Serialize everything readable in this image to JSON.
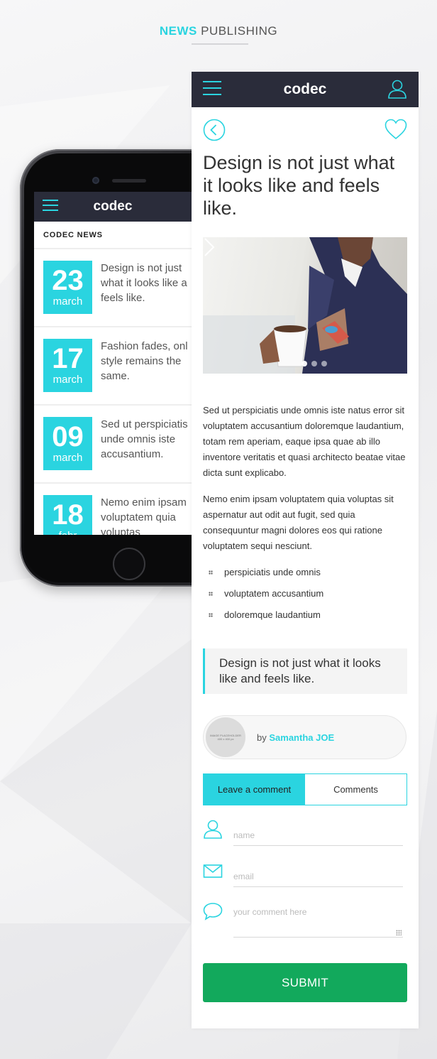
{
  "heading": {
    "accent": "NEWS",
    "rest": "PUBLISHING"
  },
  "colors": {
    "accent": "#2ad4e0",
    "header": "#2a2c3a",
    "submit": "#12a95c"
  },
  "phone": {
    "logo": "codec",
    "section_title": "CODEC NEWS",
    "items": [
      {
        "day": "23",
        "month": "march",
        "text_lines": [
          "Design is not just",
          "what it looks like a",
          "feels like."
        ]
      },
      {
        "day": "17",
        "month": "march",
        "text_lines": [
          "Fashion fades, onl",
          "style remains the",
          "same."
        ]
      },
      {
        "day": "09",
        "month": "march",
        "text_lines": [
          "Sed ut perspiciatis",
          "unde omnis iste",
          "accusantium."
        ]
      },
      {
        "day": "18",
        "month": "febr",
        "text_lines": [
          "Nemo enim ipsam",
          "voluptatem quia",
          "voluptas"
        ]
      }
    ]
  },
  "article": {
    "logo": "codec",
    "title": "Design is not just what it looks like and feels like.",
    "paragraphs": [
      "Sed ut perspiciatis unde omnis iste natus error sit voluptatem accusantium doloremque laudantium, totam rem aperiam, eaque ipsa quae ab illo inventore veritatis et quasi architecto beatae vitae dicta sunt explicabo.",
      "Nemo enim ipsam voluptatem quia voluptas sit aspernatur aut odit aut fugit, sed quia consequuntur magni dolores eos qui ratione voluptatem sequi nesciunt."
    ],
    "list": [
      "perspiciatis unde omnis",
      "voluptatem accusantium",
      "doloremque laudantium"
    ],
    "quote": "Design is not just what it looks like and feels like.",
    "author": {
      "avatar_label_1": "IMAGE PLACEHOLDER",
      "avatar_label_2": "400 x 400 px",
      "by": "by",
      "name": "Samantha JOE"
    },
    "tabs": [
      {
        "label": "Leave a comment",
        "active": true
      },
      {
        "label": "Comments",
        "active": false
      }
    ],
    "form": {
      "name_placeholder": "name",
      "email_placeholder": "email",
      "comment_placeholder": "your comment here",
      "submit_label": "SUBMIT"
    },
    "icons": {
      "menu": "menu-icon",
      "user": "user-icon",
      "back": "back-arrow-icon",
      "favorite": "heart-icon",
      "next": "chevron-right-icon",
      "email": "envelope-icon",
      "comment": "speech-bubble-icon"
    }
  }
}
